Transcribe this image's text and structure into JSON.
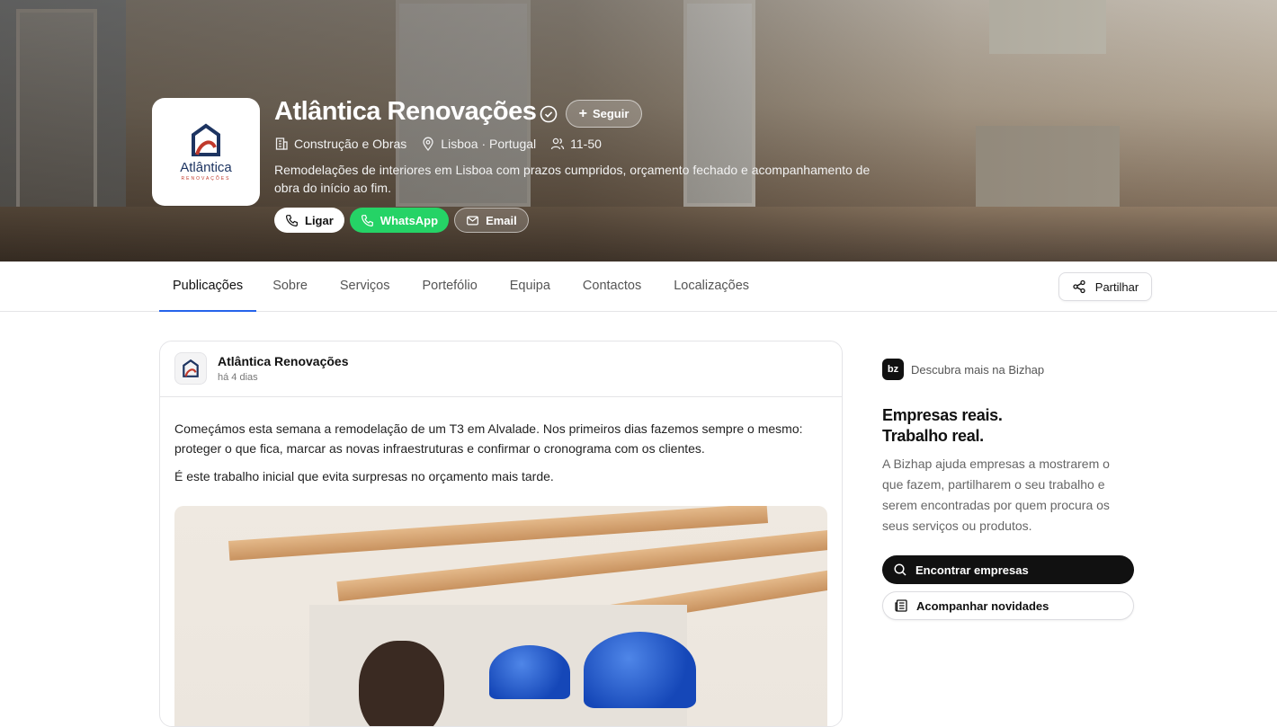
{
  "company": {
    "name": "Atlântica Renovações",
    "logo_word": "Atlântica",
    "logo_sub": "RENOVAÇÕES",
    "follow_label": "Seguir",
    "category": "Construção e Obras",
    "location": "Lisboa · Portugal",
    "size": "11-50",
    "description": "Remodelações de interiores em Lisboa com prazos cumpridos, orçamento fechado e acompanhamento de obra do início ao fim.",
    "actions": {
      "call": "Ligar",
      "whatsapp": "WhatsApp",
      "email": "Email"
    }
  },
  "tabs": [
    "Publicações",
    "Sobre",
    "Serviços",
    "Portefólio",
    "Equipa",
    "Contactos",
    "Localizações"
  ],
  "active_tab": "Publicações",
  "share_label": "Partilhar",
  "post": {
    "author": "Atlântica Renovações",
    "time": "há 4 dias",
    "paragraph1": "Começámos esta semana a remodelação de um T3 em Alvalade. Nos primeiros dias fazemos sempre o mesmo: proteger o que fica, marcar as novas infraestruturas e confirmar o cronograma com os clientes.",
    "paragraph2": "É este trabalho inicial que evita surpresas no orçamento mais tarde."
  },
  "sidebar": {
    "brand": "bz",
    "discover": "Descubra mais na Bizhap",
    "headline1": "Empresas reais.",
    "headline2": "Trabalho real.",
    "text": "A Bizhap ajuda empresas a mostrarem o que fazem, partilharem o seu trabalho e serem encontradas por quem procura os seus serviços ou produtos.",
    "primary_button": "Encontrar empresas",
    "secondary_button": "Acompanhar novidades"
  },
  "colors": {
    "accent": "#2563eb",
    "whatsapp": "#25d366",
    "logo_navy": "#1d3461",
    "logo_red": "#c0392b"
  }
}
